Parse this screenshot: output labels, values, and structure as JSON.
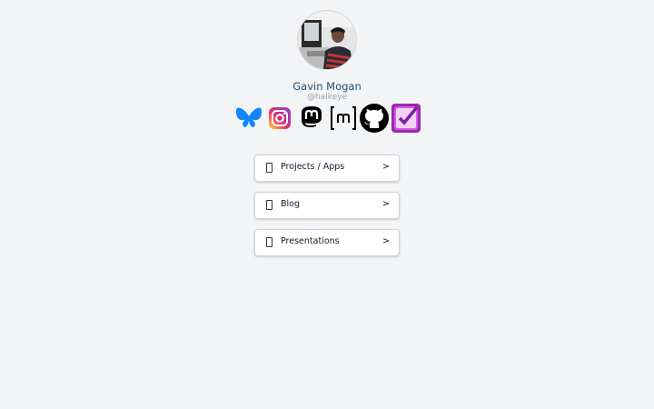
{
  "profile": {
    "name": "Gavin Mogan",
    "handle": "@halkeye"
  },
  "social_icons": [
    {
      "icon": "bluesky-icon",
      "color": "#1185fe"
    },
    {
      "icon": "instagram-icon",
      "color": "#d6249f"
    },
    {
      "icon": "mastodon-icon",
      "color": "#000000"
    },
    {
      "icon": "matrix-icon",
      "color": "#000000"
    },
    {
      "icon": "github-icon",
      "color": "#000000"
    },
    {
      "icon": "todo-checklist-icon",
      "color": "#9c27b0"
    }
  ],
  "links": [
    {
      "label": "Projects / Apps",
      "arrow": ">"
    },
    {
      "label": "Blog",
      "arrow": ">"
    },
    {
      "label": "Presentations",
      "arrow": ">"
    }
  ]
}
